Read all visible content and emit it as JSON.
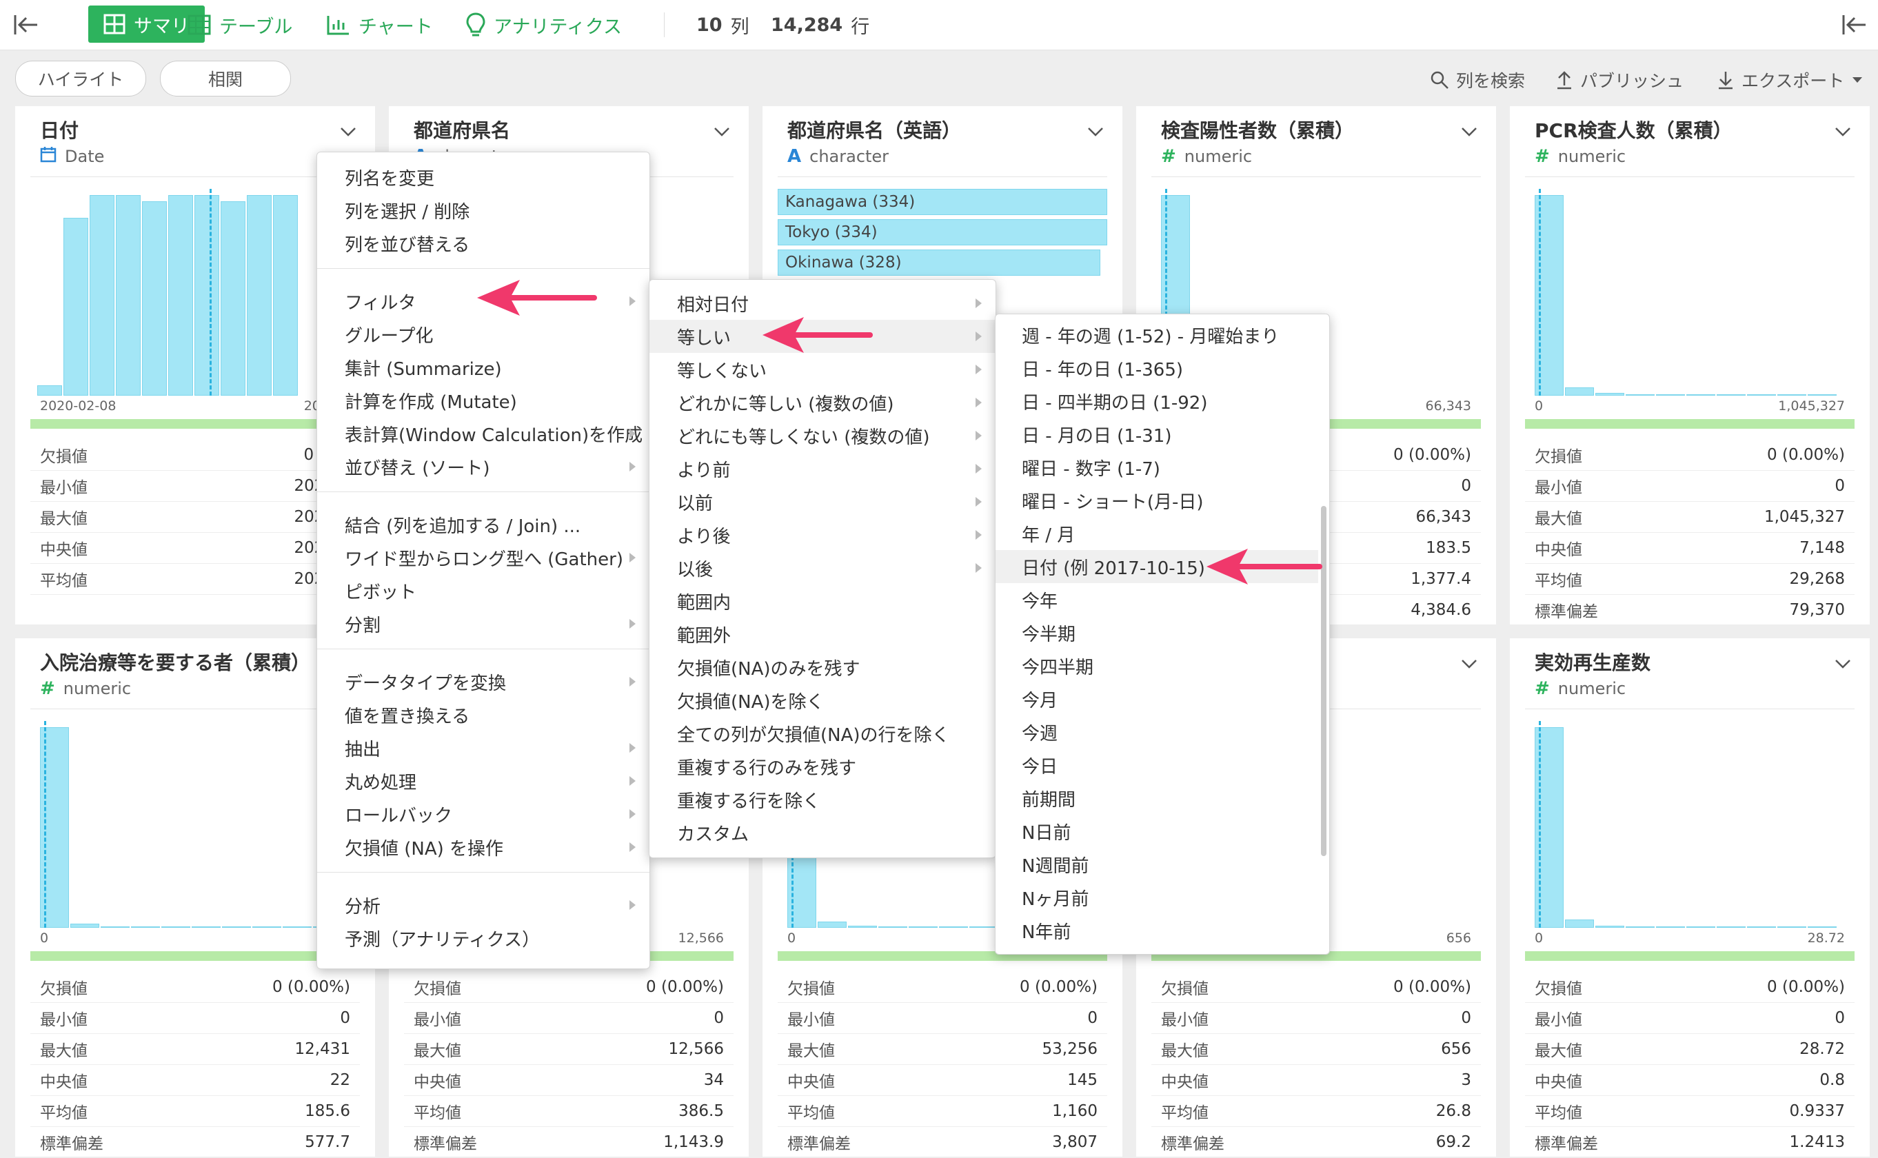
{
  "toolbar": {
    "tabs": [
      {
        "label": "サマリ",
        "active": true
      },
      {
        "label": "テーブル"
      },
      {
        "label": "チャート"
      },
      {
        "label": "アナリティクス"
      }
    ],
    "columns_count": "10",
    "columns_unit": "列",
    "rows_count": "14,284",
    "rows_unit": "行"
  },
  "subbar": {
    "highlight": "ハイライト",
    "correlation": "相関",
    "search_columns": "列を検索",
    "publish": "パブリッシュ",
    "export": "エクスポート"
  },
  "colors": {
    "accent": "#2db35d",
    "bar": "#a3e6f6",
    "median": "#2ab3df",
    "green_strip": "#b7eaa7",
    "arrow": "#f0386b"
  },
  "cards": [
    {
      "name": "日付",
      "type": "Date",
      "type_icon": "calendar-icon",
      "axis_min": "2020-02-08",
      "axis_max": "2021-0",
      "bars": [
        0.05,
        0.86,
        0.97,
        0.97,
        0.94,
        0.97,
        0.97,
        0.94,
        0.97,
        0.97
      ],
      "stats": [
        [
          "欠損値",
          "0 (0.0"
        ],
        [
          "最小値",
          "2020-0"
        ],
        [
          "最大値",
          "2021-0"
        ],
        [
          "中央値",
          "2020-0"
        ],
        [
          "平均値",
          "2020-0"
        ]
      ]
    },
    {
      "name": "都道府県名",
      "type": "character",
      "type_icon": "text-icon"
    },
    {
      "name": "都道府県名（英語）",
      "type": "character",
      "type_icon": "text-icon",
      "top_values": [
        {
          "label": "Kanagawa (334)",
          "frac": 1
        },
        {
          "label": "Tokyo (334)",
          "frac": 1
        },
        {
          "label": "Okinawa (328)",
          "frac": 0.98
        }
      ]
    },
    {
      "name": "検査陽性者数（累積）",
      "type": "numeric",
      "type_icon": "hash-icon",
      "axis_max": "66,343",
      "bars": [
        0.97
      ],
      "stats": [
        [
          "欠損値",
          "0 (0.00%)"
        ],
        [
          "最小値",
          "0"
        ],
        [
          "最大値",
          "66,343"
        ],
        [
          "中央値",
          "183.5"
        ],
        [
          "平均値",
          "1,377.4"
        ],
        [
          "標準偏差",
          "4,384.6"
        ]
      ]
    },
    {
      "name": "PCR検査人数（累積）",
      "type": "numeric",
      "type_icon": "hash-icon",
      "axis_min": "0",
      "axis_max": "1,045,327",
      "bars": [
        0.97,
        0.04,
        0.012,
        0.006,
        0.004,
        0.003,
        0.002,
        0.002,
        0.001,
        0.001
      ],
      "stats": [
        [
          "欠損値",
          "0 (0.00%)"
        ],
        [
          "最小値",
          "0"
        ],
        [
          "最大値",
          "1,045,327"
        ],
        [
          "中央値",
          "7,148"
        ],
        [
          "平均値",
          "29,268"
        ],
        [
          "標準偏差",
          "79,370"
        ]
      ]
    },
    {
      "name": "入院治療等を要する者（累積）",
      "type": "numeric",
      "type_icon": "hash-icon",
      "axis_min": "0",
      "axis_max": "1",
      "bars": [
        0.97,
        0.02,
        0.008,
        0.005,
        0.004,
        0.003,
        0.002,
        0.002,
        0.001,
        0.001
      ],
      "stats": [
        [
          "欠損値",
          "0 (0.00%)"
        ],
        [
          "最小値",
          "0"
        ],
        [
          "最大値",
          "12,431"
        ],
        [
          "中央値",
          "22"
        ],
        [
          "平均値",
          "185.6"
        ],
        [
          "標準偏差",
          "577.7"
        ]
      ]
    },
    {
      "name": "",
      "type": "",
      "axis_max": "12,566",
      "stats": [
        [
          "欠損値",
          "0 (0.00%)"
        ],
        [
          "最小値",
          "0"
        ],
        [
          "最大値",
          "12,566"
        ],
        [
          "中央値",
          "34"
        ],
        [
          "平均値",
          "386.5"
        ],
        [
          "標準偏差",
          "1,143.9"
        ]
      ]
    },
    {
      "name": "",
      "type": "",
      "axis_min": "0",
      "bars": [
        0.97,
        0.03,
        0.01,
        0.005,
        0.004,
        0.003,
        0.002,
        0.002,
        0.001,
        0.001
      ],
      "stats": [
        [
          "欠損値",
          "0 (0.00%)"
        ],
        [
          "最小値",
          "0"
        ],
        [
          "最大値",
          "53,256"
        ],
        [
          "中央値",
          "145"
        ],
        [
          "平均値",
          "1,160"
        ],
        [
          "標準偏差",
          "3,807"
        ]
      ]
    },
    {
      "name": "",
      "type": "",
      "axis_max": "656",
      "stats": [
        [
          "欠損値",
          "0 (0.00%)"
        ],
        [
          "最小値",
          "0"
        ],
        [
          "最大値",
          "656"
        ],
        [
          "中央値",
          "3"
        ],
        [
          "平均値",
          "26.8"
        ],
        [
          "標準偏差",
          "69.2"
        ]
      ]
    },
    {
      "name": "実効再生産数",
      "type": "numeric",
      "type_icon": "hash-icon",
      "axis_min": "0",
      "axis_max": "28.72",
      "bars": [
        0.97,
        0.04,
        0.01,
        0.005,
        0.004,
        0.003,
        0.002,
        0.002,
        0.001,
        0.001
      ],
      "stats": [
        [
          "欠損値",
          "0 (0.00%)"
        ],
        [
          "最小値",
          "0"
        ],
        [
          "最大値",
          "28.72"
        ],
        [
          "中央値",
          "0.8"
        ],
        [
          "平均値",
          "0.9337"
        ],
        [
          "標準偏差",
          "1.2413"
        ]
      ]
    }
  ],
  "menu1": {
    "groups": [
      [
        "列名を変更",
        "列を選択 / 削除",
        "列を並び替える"
      ],
      [
        "フィルタ",
        "グループ化",
        "集計 (Summarize)",
        "計算を作成 (Mutate)",
        "表計算(Window Calculation)を作成",
        "並び替え (ソート)"
      ],
      [
        "結合 (列を追加する / Join) ...",
        "ワイド型からロング型へ (Gather)",
        "ピボット",
        "分割"
      ],
      [
        "データタイプを変換",
        "値を置き換える",
        "抽出",
        "丸め処理",
        "ロールバック",
        "欠損値 (NA) を操作"
      ],
      [
        "分析",
        "予測（アナリティクス）"
      ]
    ],
    "submenu_items": [
      "フィルタ",
      "表計算(Window Calculation)を作成",
      "並び替え (ソート)",
      "ワイド型からロング型へ (Gather)",
      "分割",
      "データタイプを変換",
      "抽出",
      "丸め処理",
      "ロールバック",
      "欠損値 (NA) を操作",
      "分析"
    ]
  },
  "menu2": {
    "items": [
      "相対日付",
      "等しい",
      "等しくない",
      "どれかに等しい (複数の値)",
      "どれにも等しくない (複数の値)",
      "より前",
      "以前",
      "より後",
      "以後",
      "範囲内",
      "範囲外",
      "欠損値(NA)のみを残す",
      "欠損値(NA)を除く",
      "全ての列が欠損値(NA)の行を除く",
      "重複する行のみを残す",
      "重複する行を除く",
      "カスタム"
    ],
    "highlighted": "等しい",
    "submenu_count": 9
  },
  "menu3": {
    "items": [
      "週 - 年の週 (1-52) - 月曜始まり",
      "日 - 年の日 (1-365)",
      "日 - 四半期の日 (1-92)",
      "日 - 月の日 (1-31)",
      "曜日 - 数字 (1-7)",
      "曜日 - ショート(月-日)",
      "年 / 月",
      "日付 (例 2017-10-15)",
      "今年",
      "今半期",
      "今四半期",
      "今月",
      "今週",
      "今日",
      "前期間",
      "N日前",
      "N週間前",
      "Nヶ月前",
      "N年前"
    ],
    "highlighted": "日付 (例 2017-10-15)"
  }
}
